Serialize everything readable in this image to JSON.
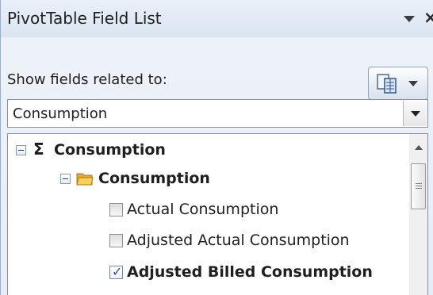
{
  "panel": {
    "title": "PivotTable Field List",
    "title_icons": [
      "dropdown-arrow-icon",
      "close-icon"
    ],
    "close_glyph": "×",
    "layout_button_icon": "field-layout-icon",
    "show_fields_label": "Show fields related to:",
    "combo": {
      "value": "Consumption",
      "icon": "chevron-down-icon"
    }
  },
  "tree": {
    "group": {
      "label": "Consumption",
      "icon": "sigma-icon",
      "sigma": "Σ",
      "expanded": true
    },
    "folder": {
      "label": "Consumption",
      "icon": "folder-icon",
      "expanded": true
    },
    "fields": [
      {
        "label": "Actual Consumption",
        "checked": false
      },
      {
        "label": "Adjusted Actual Consumption",
        "checked": false
      },
      {
        "label": "Adjusted Billed Consumption",
        "checked": true
      }
    ],
    "checkmark": "✓"
  },
  "colors": {
    "panel_background": "#e6edf6",
    "border": "#8f8f8f",
    "folder": "#f3c24a",
    "checkmark": "#2a4f90"
  }
}
